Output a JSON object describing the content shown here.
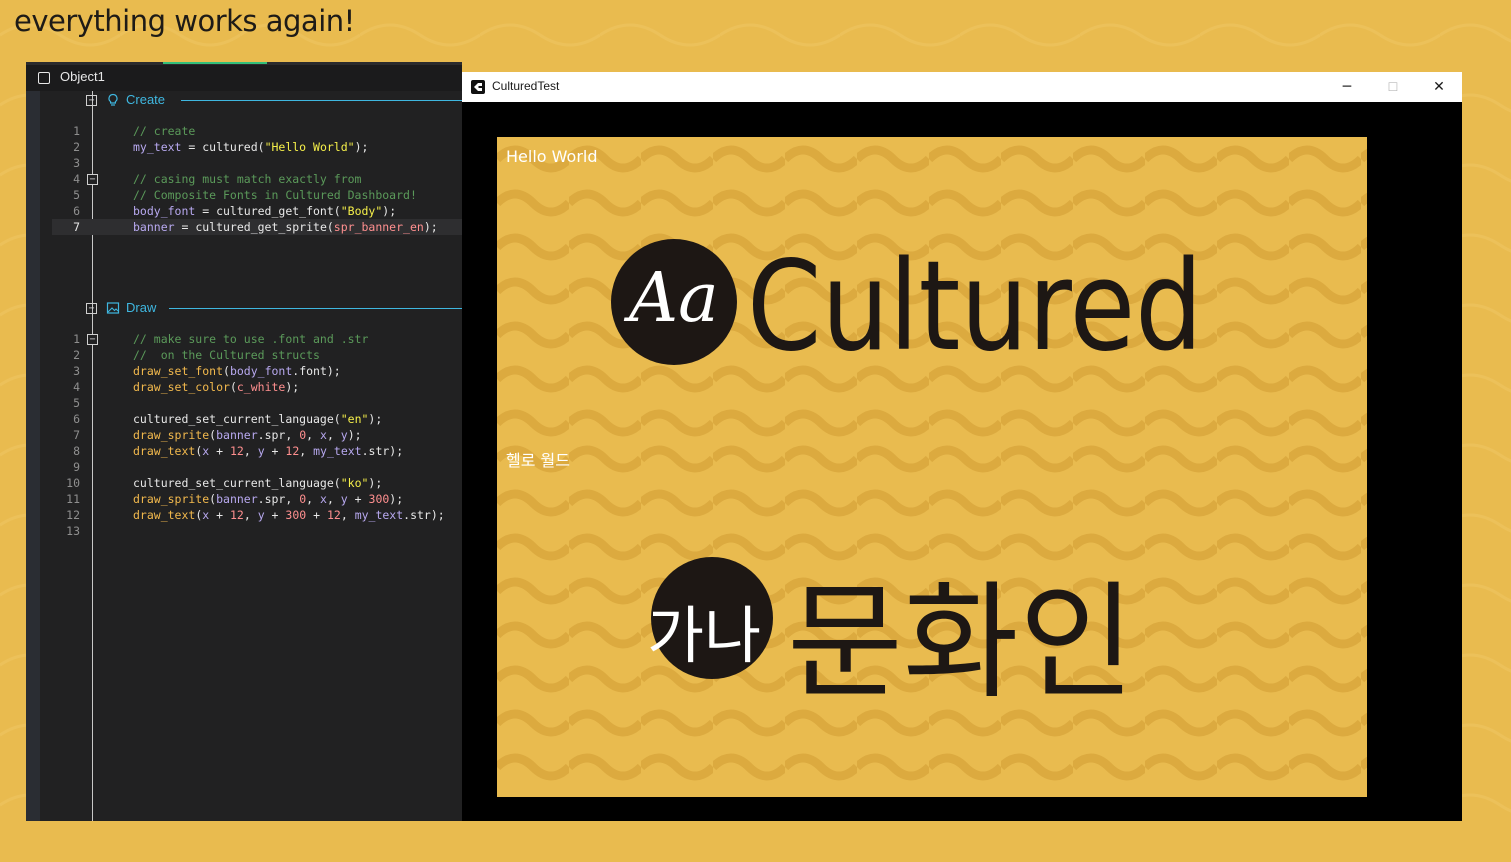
{
  "caption": "everything works again!",
  "ide": {
    "object_title": "Object1",
    "create": {
      "label": "Create",
      "lines": [
        {
          "n": "1",
          "tokens": [
            {
              "t": "// create",
              "c": "c-com"
            }
          ]
        },
        {
          "n": "2",
          "tokens": [
            {
              "t": "my_text",
              "c": "c-var"
            },
            {
              "t": " = cultured(",
              "c": "c-plain"
            },
            {
              "t": "\"Hello World\"",
              "c": "c-str"
            },
            {
              "t": ");",
              "c": "c-plain"
            }
          ]
        },
        {
          "n": "3",
          "tokens": []
        },
        {
          "n": "4",
          "tokens": [
            {
              "t": "// casing must match exactly from",
              "c": "c-com"
            }
          ]
        },
        {
          "n": "5",
          "tokens": [
            {
              "t": "// Composite Fonts in Cultured Dashboard!",
              "c": "c-com"
            }
          ]
        },
        {
          "n": "6",
          "tokens": [
            {
              "t": "body_font",
              "c": "c-var"
            },
            {
              "t": " = cultured_get_font(",
              "c": "c-plain"
            },
            {
              "t": "\"Body\"",
              "c": "c-str"
            },
            {
              "t": ");",
              "c": "c-plain"
            }
          ]
        },
        {
          "n": "7",
          "tokens": [
            {
              "t": "banner",
              "c": "c-var"
            },
            {
              "t": " = cultured_get_sprite(",
              "c": "c-plain"
            },
            {
              "t": "spr_banner_en",
              "c": "c-asset"
            },
            {
              "t": ");",
              "c": "c-plain"
            }
          ]
        }
      ]
    },
    "draw": {
      "label": "Draw",
      "lines": [
        {
          "n": "1",
          "tokens": [
            {
              "t": "// make sure to use .font and .str",
              "c": "c-com"
            }
          ]
        },
        {
          "n": "2",
          "tokens": [
            {
              "t": "//  on the Cultured structs",
              "c": "c-com"
            }
          ]
        },
        {
          "n": "3",
          "tokens": [
            {
              "t": "draw_set_font",
              "c": "c-fn"
            },
            {
              "t": "(",
              "c": "c-plain"
            },
            {
              "t": "body_font",
              "c": "c-var"
            },
            {
              "t": ".font);",
              "c": "c-plain"
            }
          ]
        },
        {
          "n": "4",
          "tokens": [
            {
              "t": "draw_set_color",
              "c": "c-fn"
            },
            {
              "t": "(",
              "c": "c-plain"
            },
            {
              "t": "c_white",
              "c": "c-con"
            },
            {
              "t": ");",
              "c": "c-plain"
            }
          ]
        },
        {
          "n": "5",
          "tokens": []
        },
        {
          "n": "6",
          "tokens": [
            {
              "t": "cultured_set_current_language(",
              "c": "c-plain"
            },
            {
              "t": "\"en\"",
              "c": "c-str"
            },
            {
              "t": ");",
              "c": "c-plain"
            }
          ]
        },
        {
          "n": "7",
          "tokens": [
            {
              "t": "draw_sprite",
              "c": "c-fn"
            },
            {
              "t": "(",
              "c": "c-plain"
            },
            {
              "t": "banner",
              "c": "c-var"
            },
            {
              "t": ".spr, ",
              "c": "c-plain"
            },
            {
              "t": "0",
              "c": "c-num"
            },
            {
              "t": ", ",
              "c": "c-plain"
            },
            {
              "t": "x",
              "c": "c-var"
            },
            {
              "t": ", ",
              "c": "c-plain"
            },
            {
              "t": "y",
              "c": "c-var"
            },
            {
              "t": ");",
              "c": "c-plain"
            }
          ]
        },
        {
          "n": "8",
          "tokens": [
            {
              "t": "draw_text",
              "c": "c-fn"
            },
            {
              "t": "(",
              "c": "c-plain"
            },
            {
              "t": "x",
              "c": "c-var"
            },
            {
              "t": " + ",
              "c": "c-plain"
            },
            {
              "t": "12",
              "c": "c-num"
            },
            {
              "t": ", ",
              "c": "c-plain"
            },
            {
              "t": "y",
              "c": "c-var"
            },
            {
              "t": " + ",
              "c": "c-plain"
            },
            {
              "t": "12",
              "c": "c-num"
            },
            {
              "t": ", ",
              "c": "c-plain"
            },
            {
              "t": "my_text",
              "c": "c-var"
            },
            {
              "t": ".str);",
              "c": "c-plain"
            }
          ]
        },
        {
          "n": "9",
          "tokens": []
        },
        {
          "n": "10",
          "tokens": [
            {
              "t": "cultured_set_current_language(",
              "c": "c-plain"
            },
            {
              "t": "\"ko\"",
              "c": "c-str"
            },
            {
              "t": ");",
              "c": "c-plain"
            }
          ]
        },
        {
          "n": "11",
          "tokens": [
            {
              "t": "draw_sprite",
              "c": "c-fn"
            },
            {
              "t": "(",
              "c": "c-plain"
            },
            {
              "t": "banner",
              "c": "c-var"
            },
            {
              "t": ".spr, ",
              "c": "c-plain"
            },
            {
              "t": "0",
              "c": "c-num"
            },
            {
              "t": ", ",
              "c": "c-plain"
            },
            {
              "t": "x",
              "c": "c-var"
            },
            {
              "t": ", ",
              "c": "c-plain"
            },
            {
              "t": "y",
              "c": "c-var"
            },
            {
              "t": " + ",
              "c": "c-plain"
            },
            {
              "t": "300",
              "c": "c-num"
            },
            {
              "t": ");",
              "c": "c-plain"
            }
          ]
        },
        {
          "n": "12",
          "tokens": [
            {
              "t": "draw_text",
              "c": "c-fn"
            },
            {
              "t": "(",
              "c": "c-plain"
            },
            {
              "t": "x",
              "c": "c-var"
            },
            {
              "t": " + ",
              "c": "c-plain"
            },
            {
              "t": "12",
              "c": "c-num"
            },
            {
              "t": ", ",
              "c": "c-plain"
            },
            {
              "t": "y",
              "c": "c-var"
            },
            {
              "t": " + ",
              "c": "c-plain"
            },
            {
              "t": "300",
              "c": "c-num"
            },
            {
              "t": " + ",
              "c": "c-plain"
            },
            {
              "t": "12",
              "c": "c-num"
            },
            {
              "t": ", ",
              "c": "c-plain"
            },
            {
              "t": "my_text",
              "c": "c-var"
            },
            {
              "t": ".str);",
              "c": "c-plain"
            }
          ]
        },
        {
          "n": "13",
          "tokens": []
        }
      ]
    }
  },
  "window": {
    "title": "CulturedTest",
    "minimize": "─",
    "maximize": "☐",
    "close": "✕"
  },
  "banners": {
    "en": {
      "text": "Hello World",
      "logo_mark": "Aa",
      "logo_word": "Cultured"
    },
    "ko": {
      "text": "헬로 월드",
      "logo_mark": "가나",
      "logo_word": "문화인"
    }
  },
  "colors": {
    "background": "#e9bb4f",
    "ink": "#1d1714",
    "accent": "#3fb7e0"
  }
}
